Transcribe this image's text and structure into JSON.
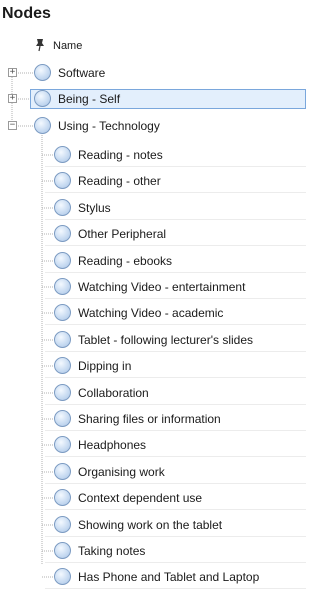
{
  "panel": {
    "title": "Nodes"
  },
  "header": {
    "pin_icon": "pushpin-icon",
    "name_col": "Name"
  },
  "root_nodes": [
    {
      "label": "Software",
      "expander": "+",
      "selected": false
    },
    {
      "label": "Being - Self",
      "expander": "+",
      "selected": true
    },
    {
      "label": "Using - Technology",
      "expander": "−",
      "selected": false
    }
  ],
  "child_nodes": [
    {
      "label": "Reading - notes"
    },
    {
      "label": "Reading - other"
    },
    {
      "label": "Stylus"
    },
    {
      "label": "Other Peripheral"
    },
    {
      "label": "Reading - ebooks"
    },
    {
      "label": "Watching Video - entertainment"
    },
    {
      "label": "Watching Video - academic"
    },
    {
      "label": "Tablet - following lecturer's slides"
    },
    {
      "label": "Dipping in"
    },
    {
      "label": "Collaboration"
    },
    {
      "label": "Sharing files or information"
    },
    {
      "label": "Headphones"
    },
    {
      "label": "Organising work"
    },
    {
      "label": "Context dependent use"
    },
    {
      "label": "Showing work on the tablet"
    },
    {
      "label": "Taking notes"
    },
    {
      "label": "Has Phone and Tablet and Laptop"
    }
  ],
  "colors": {
    "selection_bg": "#e3effc",
    "selection_border": "#7aa7dc",
    "node_circle": "#c9dcf2"
  }
}
